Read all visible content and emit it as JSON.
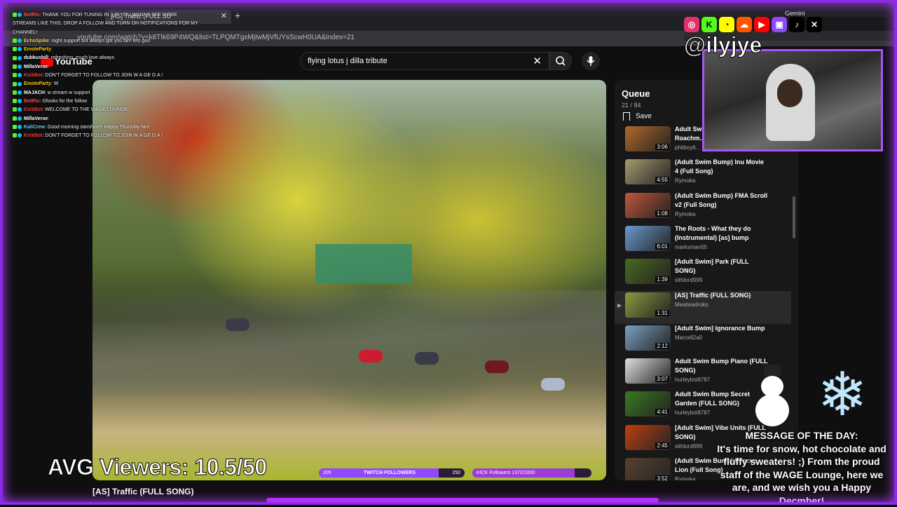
{
  "browser": {
    "tab_title": "[AS] Traffic (FULL SO",
    "new_tab": "+",
    "url": "youtube.com/watch?v=k8TIk69P4WQ&list=TLPQMTgxMjIwMjVfUYsScwH0UA&index=21",
    "gemini_label": "Gemini"
  },
  "youtube": {
    "logo": "YouTube",
    "search_value": "flying lotus j dilla tribute",
    "clear_glyph": "✕",
    "search_glyph": "⌕",
    "mic_glyph": "🎙",
    "video_title": "[AS] Traffic (FULL SONG)"
  },
  "queue": {
    "title": "Queue",
    "count": "21 / 84",
    "save_label": "Save",
    "items": [
      {
        "title": "Adult Swim Bump",
        "title2": "Roachm...",
        "channel": "philboy6...",
        "duration": "3:06",
        "color": "#b06a2a"
      },
      {
        "title": "(Adult Swim Bump) Inu Movie",
        "title2": "4 (Full Song)",
        "channel": "Rymoka",
        "duration": "4:55",
        "color": "#a89a70"
      },
      {
        "title": "(Adult Swim Bump) FMA Scroll",
        "title2": "v2 (Full Song)",
        "channel": "Rymoka",
        "duration": "1:08",
        "color": "#c0563a"
      },
      {
        "title": "The Roots - What they do",
        "title2": "(Instrumental) [as] bump",
        "channel": "marksman55",
        "duration": "6:01",
        "color": "#6a9ad0"
      },
      {
        "title": "[Adult Swim] Park (FULL",
        "title2": "SONG)",
        "channel": "sithlord999",
        "duration": "1:39",
        "color": "#4a6a20"
      },
      {
        "title": "[AS] Traffic (FULL SONG)",
        "title2": "",
        "channel": "Meatwadroks",
        "duration": "1:31",
        "color": "#8a9a40"
      },
      {
        "title": "[Adult Swim] Ignorance Bump",
        "title2": "",
        "channel": "Marcell2a0",
        "duration": "2:12",
        "color": "#7aa0c0"
      },
      {
        "title": "Adult Swim Bump Piano (FULL",
        "title2": "SONG)",
        "channel": "hurleyboi8787",
        "duration": "3:07",
        "color": "#e0e0e0"
      },
      {
        "title": "Adult Swim Bump Secret",
        "title2": "Garden (FULL SONG)",
        "channel": "hurleyboi8787",
        "duration": "4:41",
        "color": "#3a7a20"
      },
      {
        "title": "[Adult Swim] Vibe Units (FULL",
        "title2": "SONG)",
        "channel": "sithlord999",
        "duration": "2:45",
        "color": "#c04010"
      },
      {
        "title": "(Adult Swim Bump) Rescue",
        "title2": "Lion (Full Song)",
        "channel": "Rymoka",
        "duration": "3:52",
        "color": "#5a4030"
      }
    ]
  },
  "chat": [
    {
      "user": "BotRix",
      "text": ": THANK YOU FOR TUNING IN :) IF YOU WANNA SEE MORE STREAMS LIKE THIS, DROP A FOLLOW AND TURN ON NOTIFICATIONS FOR MY CHANNEL!",
      "color": "#ff4d4d"
    },
    {
      "user": "EchoSpike",
      "text": ": night support but always got you fam lets goo",
      "color": "#ffcc66"
    },
    {
      "user": "EmoteParty",
      "text": ":",
      "color": "#ffcc00"
    },
    {
      "user": "dubkushill",
      "text": ": refreshing, much love always",
      "color": "#ffffff"
    },
    {
      "user": "MillaVerse",
      "text": ":",
      "color": "#ffffff"
    },
    {
      "user": "KickBot",
      "text": ": DON'T FORGET TO FOLLOW TO JOIN W A GE G A !",
      "color": "#ff3b3b"
    },
    {
      "user": "EmoteParty",
      "text": ": W",
      "color": "#ffcc00"
    },
    {
      "user": "MAJACH",
      "text": ": w stream w support",
      "color": "#ffffff"
    },
    {
      "user": "BotRix",
      "text": ": Gfooks for the follow",
      "color": "#ff4d4d"
    },
    {
      "user": "KickBot",
      "text": ": WELCOME TO THE WAGE LOUNGE",
      "color": "#ff3b3b"
    },
    {
      "user": "MillaVerse",
      "text": ":",
      "color": "#ffffff"
    },
    {
      "user": "KaliCrew",
      "text": ": Good morning starshine!! Happy Thursday fam",
      "color": "#66ccff"
    },
    {
      "user": "KickBot",
      "text": ": DON'T FORGET TO FOLLOW TO JOIN W A GE G A !",
      "color": "#ff3b3b"
    }
  ],
  "overlay": {
    "handle": "@ilyjye",
    "social_icons": [
      "instagram-icon",
      "kick-icon",
      "snapchat-icon",
      "soundcloud-icon",
      "youtube-icon",
      "twitch-icon",
      "tiktok-icon",
      "x-icon"
    ],
    "avg_viewers": "AVG Viewers: 10.5/50",
    "twitch_bar": {
      "label": "TWITCH FOLLOWERS",
      "current": "205",
      "goal": "250",
      "progress": 0.82,
      "color": "#9146ff"
    },
    "kick_bar": {
      "label": "KICK Followers 1372/1600",
      "progress": 0.86,
      "color": "#9b3bd8"
    },
    "motd_title": "MESSAGE OF THE DAY:",
    "motd_lines": [
      "It's time for snow, hot chocolate and",
      "fluffy sweaters! ;) From the proud",
      "staff of the WAGE Lounge, here we",
      "are, and we wish you a Happy Decmber!"
    ]
  }
}
